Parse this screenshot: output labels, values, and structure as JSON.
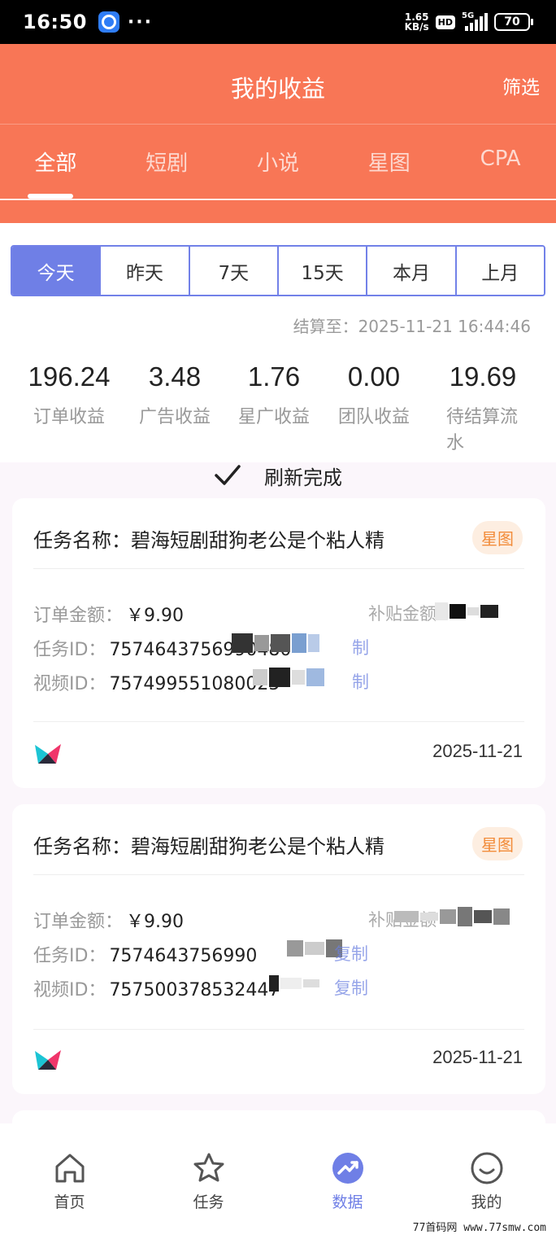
{
  "status_bar": {
    "time": "16:50",
    "dots": "···",
    "speed": "1.65",
    "speed_unit": "KB/s",
    "hd": "HD",
    "network": "5G",
    "battery": "70"
  },
  "header": {
    "title": "我的收益",
    "filter": "筛选"
  },
  "category_tabs": [
    "全部",
    "短剧",
    "小说",
    "星图",
    "CPA"
  ],
  "period_tabs": [
    "今天",
    "昨天",
    "7天",
    "15天",
    "本月",
    "上月"
  ],
  "settle_text": "结算至：2025-11-21 16:44:46",
  "stats": [
    {
      "value": "196.24",
      "label": "订单收益"
    },
    {
      "value": "3.48",
      "label": "广告收益"
    },
    {
      "value": "1.76",
      "label": "星广收益"
    },
    {
      "value": "0.00",
      "label": "团队收益"
    },
    {
      "value": "19.69",
      "label": "待结算流水"
    }
  ],
  "refresh_text": "刷新完成",
  "orders": [
    {
      "title": "任务名称：碧海短剧甜狗老公是个粘人精",
      "badge": "星图",
      "amount_label": "订单金额：",
      "amount": "￥9.90",
      "subsidy_label": "补贴金额",
      "task_id_label": "任务ID：",
      "task_id": "7574643756990480",
      "video_id_label": "视频ID：",
      "video_id": "757499551080025",
      "copy_partial": "制",
      "date": "2025-11-21"
    },
    {
      "title": "任务名称：碧海短剧甜狗老公是个粘人精",
      "badge": "星图",
      "amount_label": "订单金额：",
      "amount": "￥9.90",
      "subsidy_label": "补贴金额",
      "task_id_label": "任务ID：",
      "task_id": "7574643756990",
      "video_id_label": "视频ID：",
      "video_id": "757500378532447",
      "copy_partial": "复制",
      "date": "2025-11-21"
    }
  ],
  "bottom_nav": [
    {
      "label": "首页",
      "icon": "home-icon"
    },
    {
      "label": "任务",
      "icon": "star-icon"
    },
    {
      "label": "数据",
      "icon": "data-trend-icon"
    },
    {
      "label": "我的",
      "icon": "smile-icon"
    }
  ],
  "watermark": "77首码网 www.77smw.com",
  "colors": {
    "header": "#f87656",
    "accent": "#6f7fe6",
    "badge_bg": "#fdeee1",
    "badge_text": "#f28c3a"
  }
}
